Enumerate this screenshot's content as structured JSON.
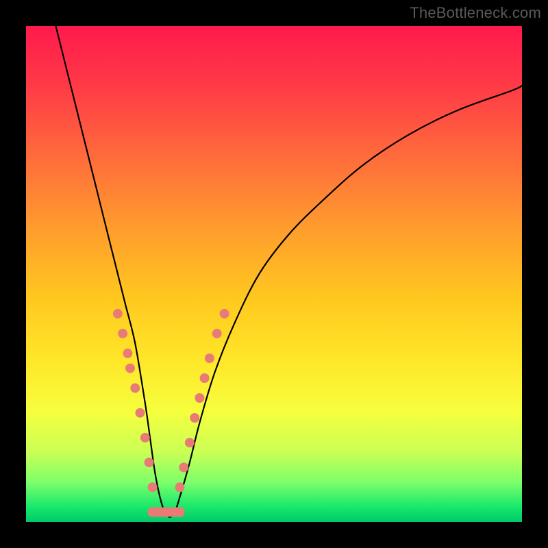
{
  "watermark": "TheBottleneck.com",
  "chart_data": {
    "type": "line",
    "title": "",
    "xlabel": "",
    "ylabel": "",
    "xlim": [
      0,
      100
    ],
    "ylim": [
      0,
      100
    ],
    "grid": false,
    "legend": false,
    "background_gradient": {
      "direction": "vertical",
      "stops": [
        {
          "pos": 0.0,
          "color": "#ff1a4d"
        },
        {
          "pos": 0.12,
          "color": "#ff3a46"
        },
        {
          "pos": 0.26,
          "color": "#ff6a3c"
        },
        {
          "pos": 0.4,
          "color": "#ff9a2e"
        },
        {
          "pos": 0.55,
          "color": "#ffc81f"
        },
        {
          "pos": 0.68,
          "color": "#ffe82a"
        },
        {
          "pos": 0.78,
          "color": "#f5ff3e"
        },
        {
          "pos": 0.86,
          "color": "#c9ff55"
        },
        {
          "pos": 0.92,
          "color": "#7dff6a"
        },
        {
          "pos": 0.97,
          "color": "#17e86b"
        },
        {
          "pos": 1.0,
          "color": "#00c86a"
        }
      ]
    },
    "series": [
      {
        "name": "bottleneck-curve",
        "color": "#000000",
        "x": [
          6,
          8,
          10,
          12,
          14,
          16,
          18,
          20,
          22,
          24,
          25,
          26,
          27,
          28,
          29,
          30,
          31,
          33,
          35,
          38,
          42,
          47,
          53,
          60,
          68,
          77,
          87,
          98,
          100
        ],
        "y": [
          100,
          92,
          84,
          76,
          68,
          60,
          52,
          44,
          36,
          24,
          17,
          10,
          5,
          2,
          1,
          2,
          5,
          12,
          20,
          30,
          40,
          50,
          58,
          65,
          72,
          78,
          83,
          87,
          88
        ]
      }
    ],
    "markers": {
      "name": "highlight-dots",
      "color": "#e97b76",
      "radius": 7,
      "points": [
        {
          "x": 18.5,
          "y": 42
        },
        {
          "x": 19.5,
          "y": 38
        },
        {
          "x": 20.5,
          "y": 34
        },
        {
          "x": 21.0,
          "y": 31
        },
        {
          "x": 22.0,
          "y": 27
        },
        {
          "x": 23.0,
          "y": 22
        },
        {
          "x": 24.0,
          "y": 17
        },
        {
          "x": 24.8,
          "y": 12
        },
        {
          "x": 25.5,
          "y": 7
        },
        {
          "x": 31.0,
          "y": 7
        },
        {
          "x": 31.8,
          "y": 11
        },
        {
          "x": 33.0,
          "y": 16
        },
        {
          "x": 34.0,
          "y": 21
        },
        {
          "x": 35.0,
          "y": 25
        },
        {
          "x": 36.0,
          "y": 29
        },
        {
          "x": 37.0,
          "y": 33
        },
        {
          "x": 38.5,
          "y": 38
        },
        {
          "x": 40.0,
          "y": 42
        }
      ],
      "bottom_blob": {
        "x0": 25.5,
        "x1": 31.0,
        "y": 2,
        "height": 3
      }
    }
  }
}
